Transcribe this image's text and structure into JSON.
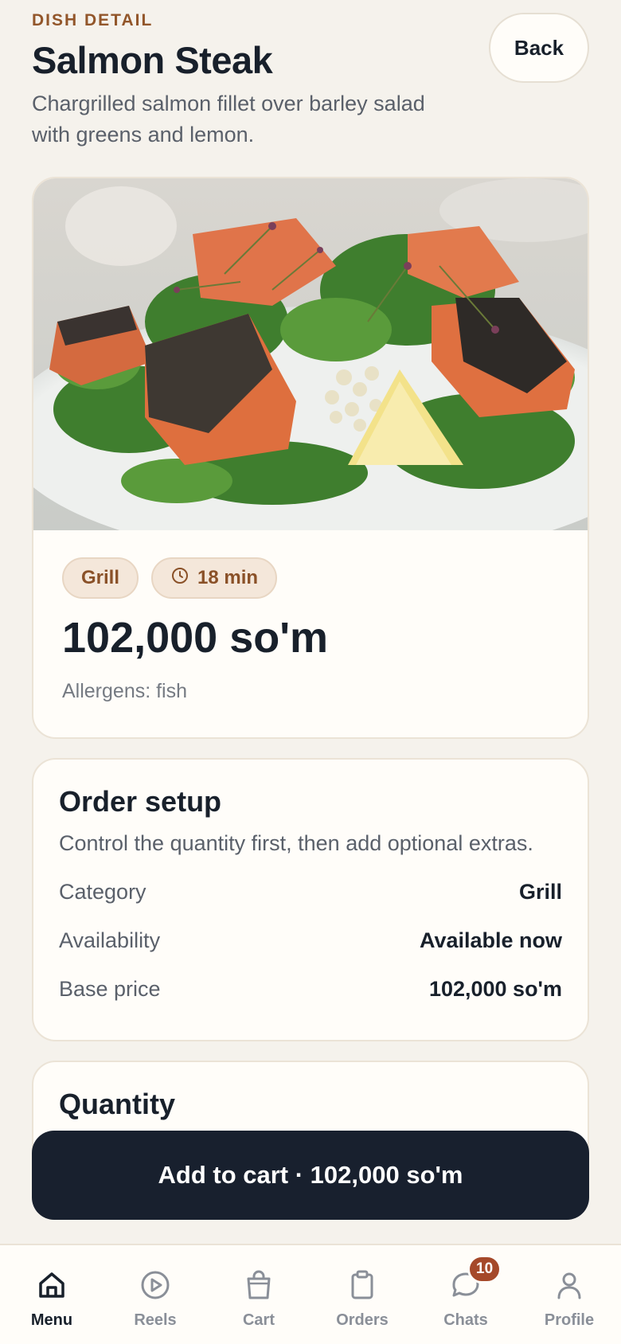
{
  "header": {
    "eyebrow": "DISH DETAIL",
    "title": "Salmon Steak",
    "subtitle": "Chargrilled salmon fillet over barley salad with greens and lemon.",
    "back_label": "Back"
  },
  "dish": {
    "image_alt": "salmon-barley-salad-photo",
    "tags": [
      {
        "label": "Grill",
        "icon": null
      },
      {
        "label": "18 min",
        "icon": "clock-icon"
      }
    ],
    "price": "102,000 so'm",
    "allergens": "Allergens: fish"
  },
  "order_setup": {
    "title": "Order setup",
    "subtitle": "Control the quantity first, then add optional extras.",
    "rows": [
      {
        "key": "Category",
        "value": "Grill"
      },
      {
        "key": "Availability",
        "value": "Available now"
      },
      {
        "key": "Base price",
        "value": "102,000 so'm"
      }
    ]
  },
  "quantity": {
    "title": "Quantity"
  },
  "cta": {
    "label": "Add to cart · 102,000 so'm"
  },
  "tabbar": {
    "items": [
      {
        "label": "Menu",
        "icon": "home-icon",
        "active": true
      },
      {
        "label": "Reels",
        "icon": "play-icon",
        "active": false
      },
      {
        "label": "Cart",
        "icon": "bag-icon",
        "active": false
      },
      {
        "label": "Orders",
        "icon": "clipboard-icon",
        "active": false
      },
      {
        "label": "Chats",
        "icon": "chat-icon",
        "active": false,
        "badge": "10"
      },
      {
        "label": "Profile",
        "icon": "user-icon",
        "active": false
      }
    ]
  },
  "colors": {
    "background": "#f5f2ec",
    "accent": "#92562a",
    "cta": "#18202e",
    "badge": "#a5492a"
  }
}
